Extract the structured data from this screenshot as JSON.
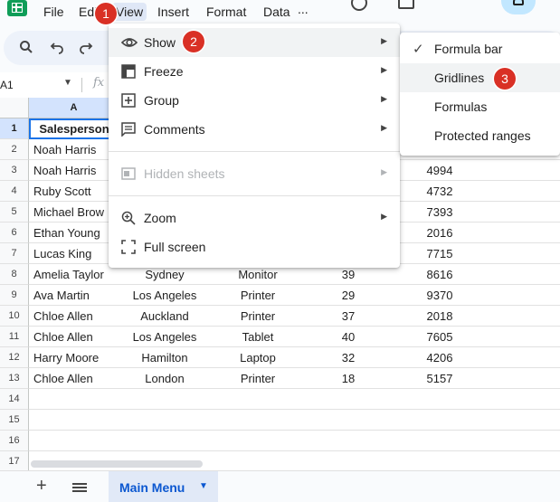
{
  "menubar": {
    "items": [
      "File",
      "Edit",
      "View",
      "Insert",
      "Format",
      "Data",
      "..."
    ]
  },
  "namebox": {
    "value": "A1",
    "fx": "fx"
  },
  "grid": {
    "column_a_header": "A",
    "row_numbers": [
      "1",
      "2",
      "3",
      "4",
      "5",
      "6",
      "7",
      "8",
      "9",
      "10",
      "11",
      "12",
      "13",
      "14",
      "15",
      "16",
      "17"
    ],
    "header_cell": "Salesperson",
    "col_a": [
      "Noah Harris",
      "Noah Harris",
      "Ruby Scott",
      "Michael Brow",
      "Ethan Young",
      "Lucas King",
      "Amelia Taylor",
      "Ava Martin",
      "Chloe Allen",
      "Chloe Allen",
      "Harry Moore",
      "Chloe Allen"
    ],
    "visible_rows": [
      {
        "b": "",
        "c": "",
        "d": "",
        "e": ""
      },
      {
        "b": "",
        "c": "",
        "d": "",
        "e": "4994"
      },
      {
        "b": "",
        "c": "",
        "d": "",
        "e": "4732"
      },
      {
        "b": "",
        "c": "",
        "d": "",
        "e": "7393"
      },
      {
        "b": "",
        "c": "",
        "d": "",
        "e": "2016"
      },
      {
        "b": "",
        "c": "",
        "d": "",
        "e": "7715"
      },
      {
        "b": "Sydney",
        "c": "Monitor",
        "d": "39",
        "e": "8616"
      },
      {
        "b": "Los Angeles",
        "c": "Printer",
        "d": "29",
        "e": "9370"
      },
      {
        "b": "Auckland",
        "c": "Printer",
        "d": "37",
        "e": "2018"
      },
      {
        "b": "Los Angeles",
        "c": "Tablet",
        "d": "40",
        "e": "7605"
      },
      {
        "b": "Hamilton",
        "c": "Laptop",
        "d": "32",
        "e": "4206"
      },
      {
        "b": "London",
        "c": "Printer",
        "d": "18",
        "e": "5157"
      }
    ]
  },
  "view_menu": {
    "items": [
      {
        "label": "Show",
        "icon": "eye-icon"
      },
      {
        "label": "Freeze",
        "icon": "freeze-icon"
      },
      {
        "label": "Group",
        "icon": "group-icon"
      },
      {
        "label": "Comments",
        "icon": "comment-icon"
      },
      {
        "label": "Hidden sheets",
        "icon": "hidden-sheets-icon"
      },
      {
        "label": "Zoom",
        "icon": "zoom-icon"
      },
      {
        "label": "Full screen",
        "icon": "fullscreen-icon"
      }
    ]
  },
  "show_submenu": {
    "items": [
      "Formula bar",
      "Gridlines",
      "Formulas",
      "Protected ranges"
    ]
  },
  "badges": [
    "1",
    "2",
    "3"
  ],
  "sheets": {
    "active": "Main Menu"
  },
  "colors": {
    "accent": "#0b57d0",
    "badge": "#d93025",
    "selection": "#1a73e8"
  }
}
